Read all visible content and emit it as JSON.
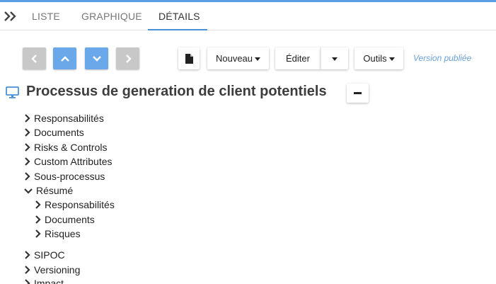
{
  "tabs": {
    "liste": "LISTE",
    "graphique": "GRAPHIQUE",
    "details": "DÉTAILS",
    "active": "details"
  },
  "toolbar": {
    "nav": [
      {
        "name": "nav-previous-button",
        "icon": "chevron-left-icon",
        "state": "disabled"
      },
      {
        "name": "nav-up-button",
        "icon": "chevron-up-icon",
        "state": "enabled"
      },
      {
        "name": "nav-down-button",
        "icon": "chevron-down-icon",
        "state": "enabled"
      },
      {
        "name": "nav-next-button",
        "icon": "chevron-right-icon",
        "state": "disabled"
      }
    ],
    "document_icon": "document-icon",
    "nouveau_label": "Nouveau",
    "editer_label": "Éditer",
    "outils_label": "Outils",
    "version_label": "Version publiée"
  },
  "colors": {
    "accent": "#4a90d9",
    "nav_enabled": "#6aa8ea",
    "nav_disabled": "#c8c8c8",
    "version_text": "#6aa0d6"
  },
  "title": {
    "icon": "monitor-icon",
    "text": "Processus de generation de client potentiels"
  },
  "tree": [
    {
      "label": "Responsabilités",
      "expanded": false,
      "level": 0
    },
    {
      "label": "Documents",
      "expanded": false,
      "level": 0
    },
    {
      "label": "Risks & Controls",
      "expanded": false,
      "level": 0
    },
    {
      "label": "Custom Attributes",
      "expanded": false,
      "level": 0
    },
    {
      "label": "Sous-processus",
      "expanded": false,
      "level": 0
    },
    {
      "label": "Résumé",
      "expanded": true,
      "level": 0
    },
    {
      "label": "Responsabilités",
      "expanded": false,
      "level": 1
    },
    {
      "label": "Documents",
      "expanded": false,
      "level": 1
    },
    {
      "label": "Risques",
      "expanded": false,
      "level": 1
    },
    {
      "label": "SIPOC",
      "expanded": false,
      "level": 0
    },
    {
      "label": "Versioning",
      "expanded": false,
      "level": 0
    },
    {
      "label": "Impact",
      "expanded": false,
      "level": 0
    }
  ]
}
